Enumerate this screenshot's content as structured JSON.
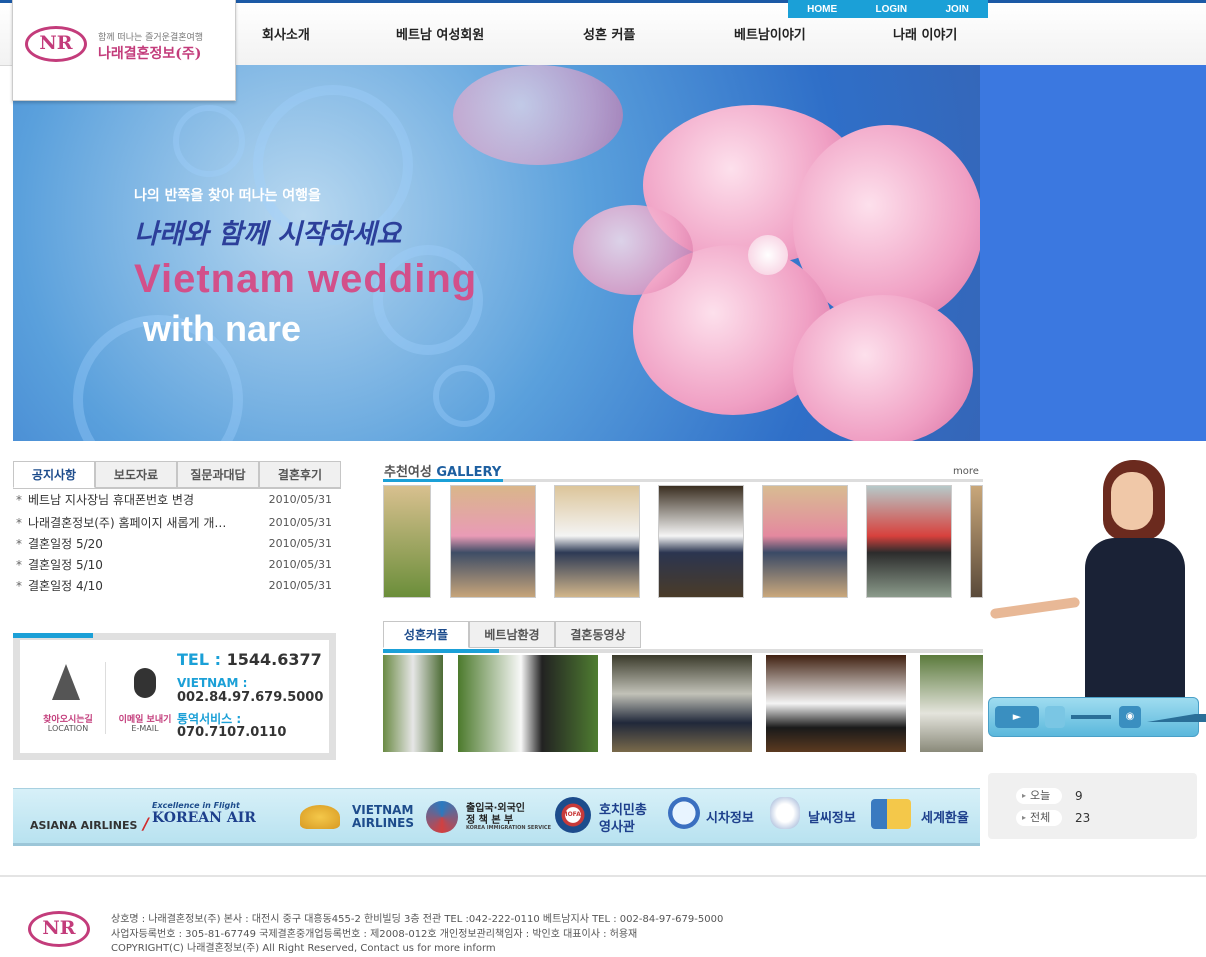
{
  "brand": {
    "logo_text": "NR",
    "tagline": "함께 떠나는 즐거운결혼여행",
    "company_name": "나래결혼정보(주)",
    "accent_color": "#c33c7b"
  },
  "util_nav": [
    "HOME",
    "LOGIN",
    "JOIN"
  ],
  "main_nav": [
    "회사소개",
    "베트남 여성회원",
    "성혼 커플",
    "베트남이야기",
    "나래 이야기"
  ],
  "banner": {
    "line1": "나의 반쪽을 찾아 떠나는 여행을",
    "line2": "나래와 함께 시작하세요",
    "line3": "Vietnam wedding",
    "line4": "with nare"
  },
  "notice": {
    "tabs": [
      "공지사항",
      "보도자료",
      "질문과대답",
      "결혼후기"
    ],
    "items": [
      {
        "title": "베트남 지사장님 휴대폰번호 변경",
        "date": "2010/05/31"
      },
      {
        "title": "나래결혼정보(주) 홈페이지 새롭게 개…",
        "date": "2010/05/31"
      },
      {
        "title": "결혼일정 5/20",
        "date": "2010/05/31"
      },
      {
        "title": "결혼일정 5/10",
        "date": "2010/05/31"
      },
      {
        "title": "결혼일정 4/10",
        "date": "2010/05/31"
      }
    ]
  },
  "contact": {
    "location_label": "찾아오시는길",
    "location_sub": "LOCATION",
    "email_label": "이메일 보내기",
    "email_sub": "E-MAIL",
    "tel_label": "TEL : ",
    "tel": "1544.6377",
    "vietnam_label": "VIETNAM :",
    "vietnam_tel": "002.84.97.679.5000",
    "interpret_label": "통역서비스 :",
    "interpret_tel": "070.7107.0110"
  },
  "gallery": {
    "title_ko": "추천여성",
    "title_en": "GALLERY",
    "more": "more"
  },
  "couple_tabs": [
    "성혼커플",
    "베트남환경",
    "결혼동영상"
  ],
  "partners": {
    "asiana": "ASIANA AIRLINES",
    "korean_tag": "Excellence in Flight",
    "korean": "KOREAN AIR",
    "vietnam1": "VIETNAM",
    "vietnam2": "AIRLINES",
    "immig1": "출입국·외국인",
    "immig2": "정 책 본 부",
    "immig3": "KOREA IMMIGRATION SERVICE",
    "consul_seal": "MOFAT",
    "consul1": "호치민총",
    "consul2": "영사관",
    "time": "시차정보",
    "weather": "날씨정보",
    "exchange": "세계환율"
  },
  "counter": {
    "today_label": "오늘",
    "today": "9",
    "total_label": "전체",
    "total": "23"
  },
  "footer": {
    "line1": "상호명 : 나래결혼정보(주) 본사 : 대전시 중구 대흥동455-2  한비빌딩 3층 전관 TEL :042-222-0110 베트남지사 TEL : 002-84-97-679-5000",
    "line2": "사업자등록번호 : 305-81-67749 국제결혼중개업등록번호 : 제2008-012호 개인정보관리책임자 : 박인호  대표이사 : 허용재",
    "line3": "COPYRIGHT(C) 나래결혼정보(주) All Right Reserved, Contact us for more inform"
  }
}
